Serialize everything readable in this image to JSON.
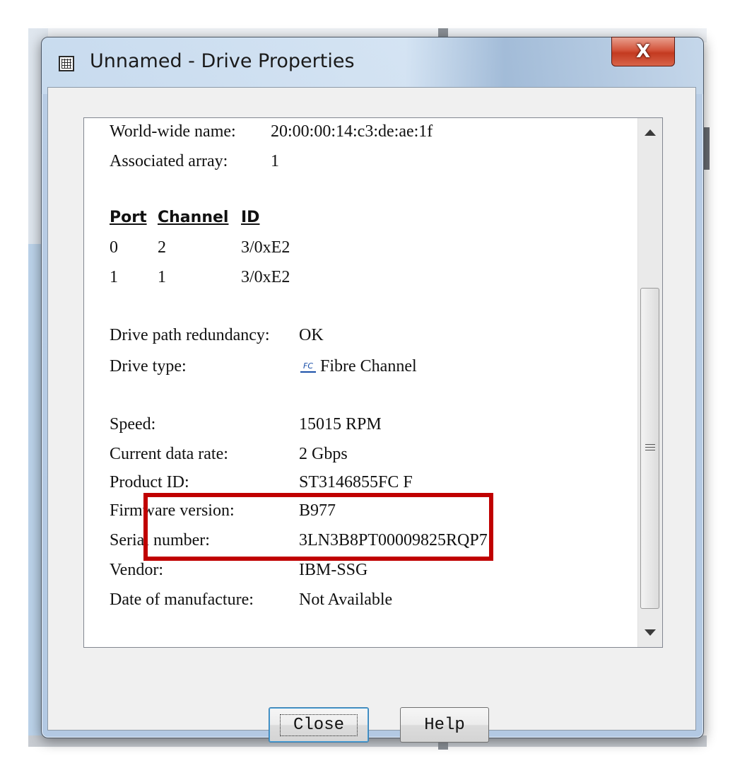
{
  "window": {
    "title": "Unnamed - Drive Properties",
    "close_glyph": "X"
  },
  "props_top": [
    {
      "label": "World-wide name:",
      "value": "20:00:00:14:c3:de:ae:1f"
    },
    {
      "label": "Associated array:",
      "value": "1"
    }
  ],
  "paths_table": {
    "headers": [
      "Port",
      "Channel",
      "ID"
    ],
    "rows": [
      [
        "0",
        "2",
        "3/0xE2"
      ],
      [
        "1",
        "1",
        "3/0xE2"
      ]
    ]
  },
  "redundancy": {
    "label": "Drive path redundancy:",
    "value": "OK"
  },
  "drive_type": {
    "label": "Drive type:",
    "icon_text": "FC",
    "value": "Fibre Channel",
    "icon": "fibre-channel-icon"
  },
  "props_bottom": [
    {
      "label": "Speed:",
      "value": "15015 RPM"
    },
    {
      "label": "Current data rate:",
      "value": "2 Gbps"
    },
    {
      "label": "Product ID:",
      "value": "ST3146855FC F"
    },
    {
      "label": "Firmware version:",
      "value": "B977"
    },
    {
      "label": "Serial number:",
      "value": "3LN3B8PT00009825RQP7"
    },
    {
      "label": "Vendor:",
      "value": "IBM-SSG"
    },
    {
      "label": "Date of manufacture:",
      "value": "Not Available"
    }
  ],
  "buttons": {
    "close": "Close",
    "help": "Help"
  },
  "colors": {
    "highlight": "#c00000",
    "close_button": "#c33a20"
  }
}
